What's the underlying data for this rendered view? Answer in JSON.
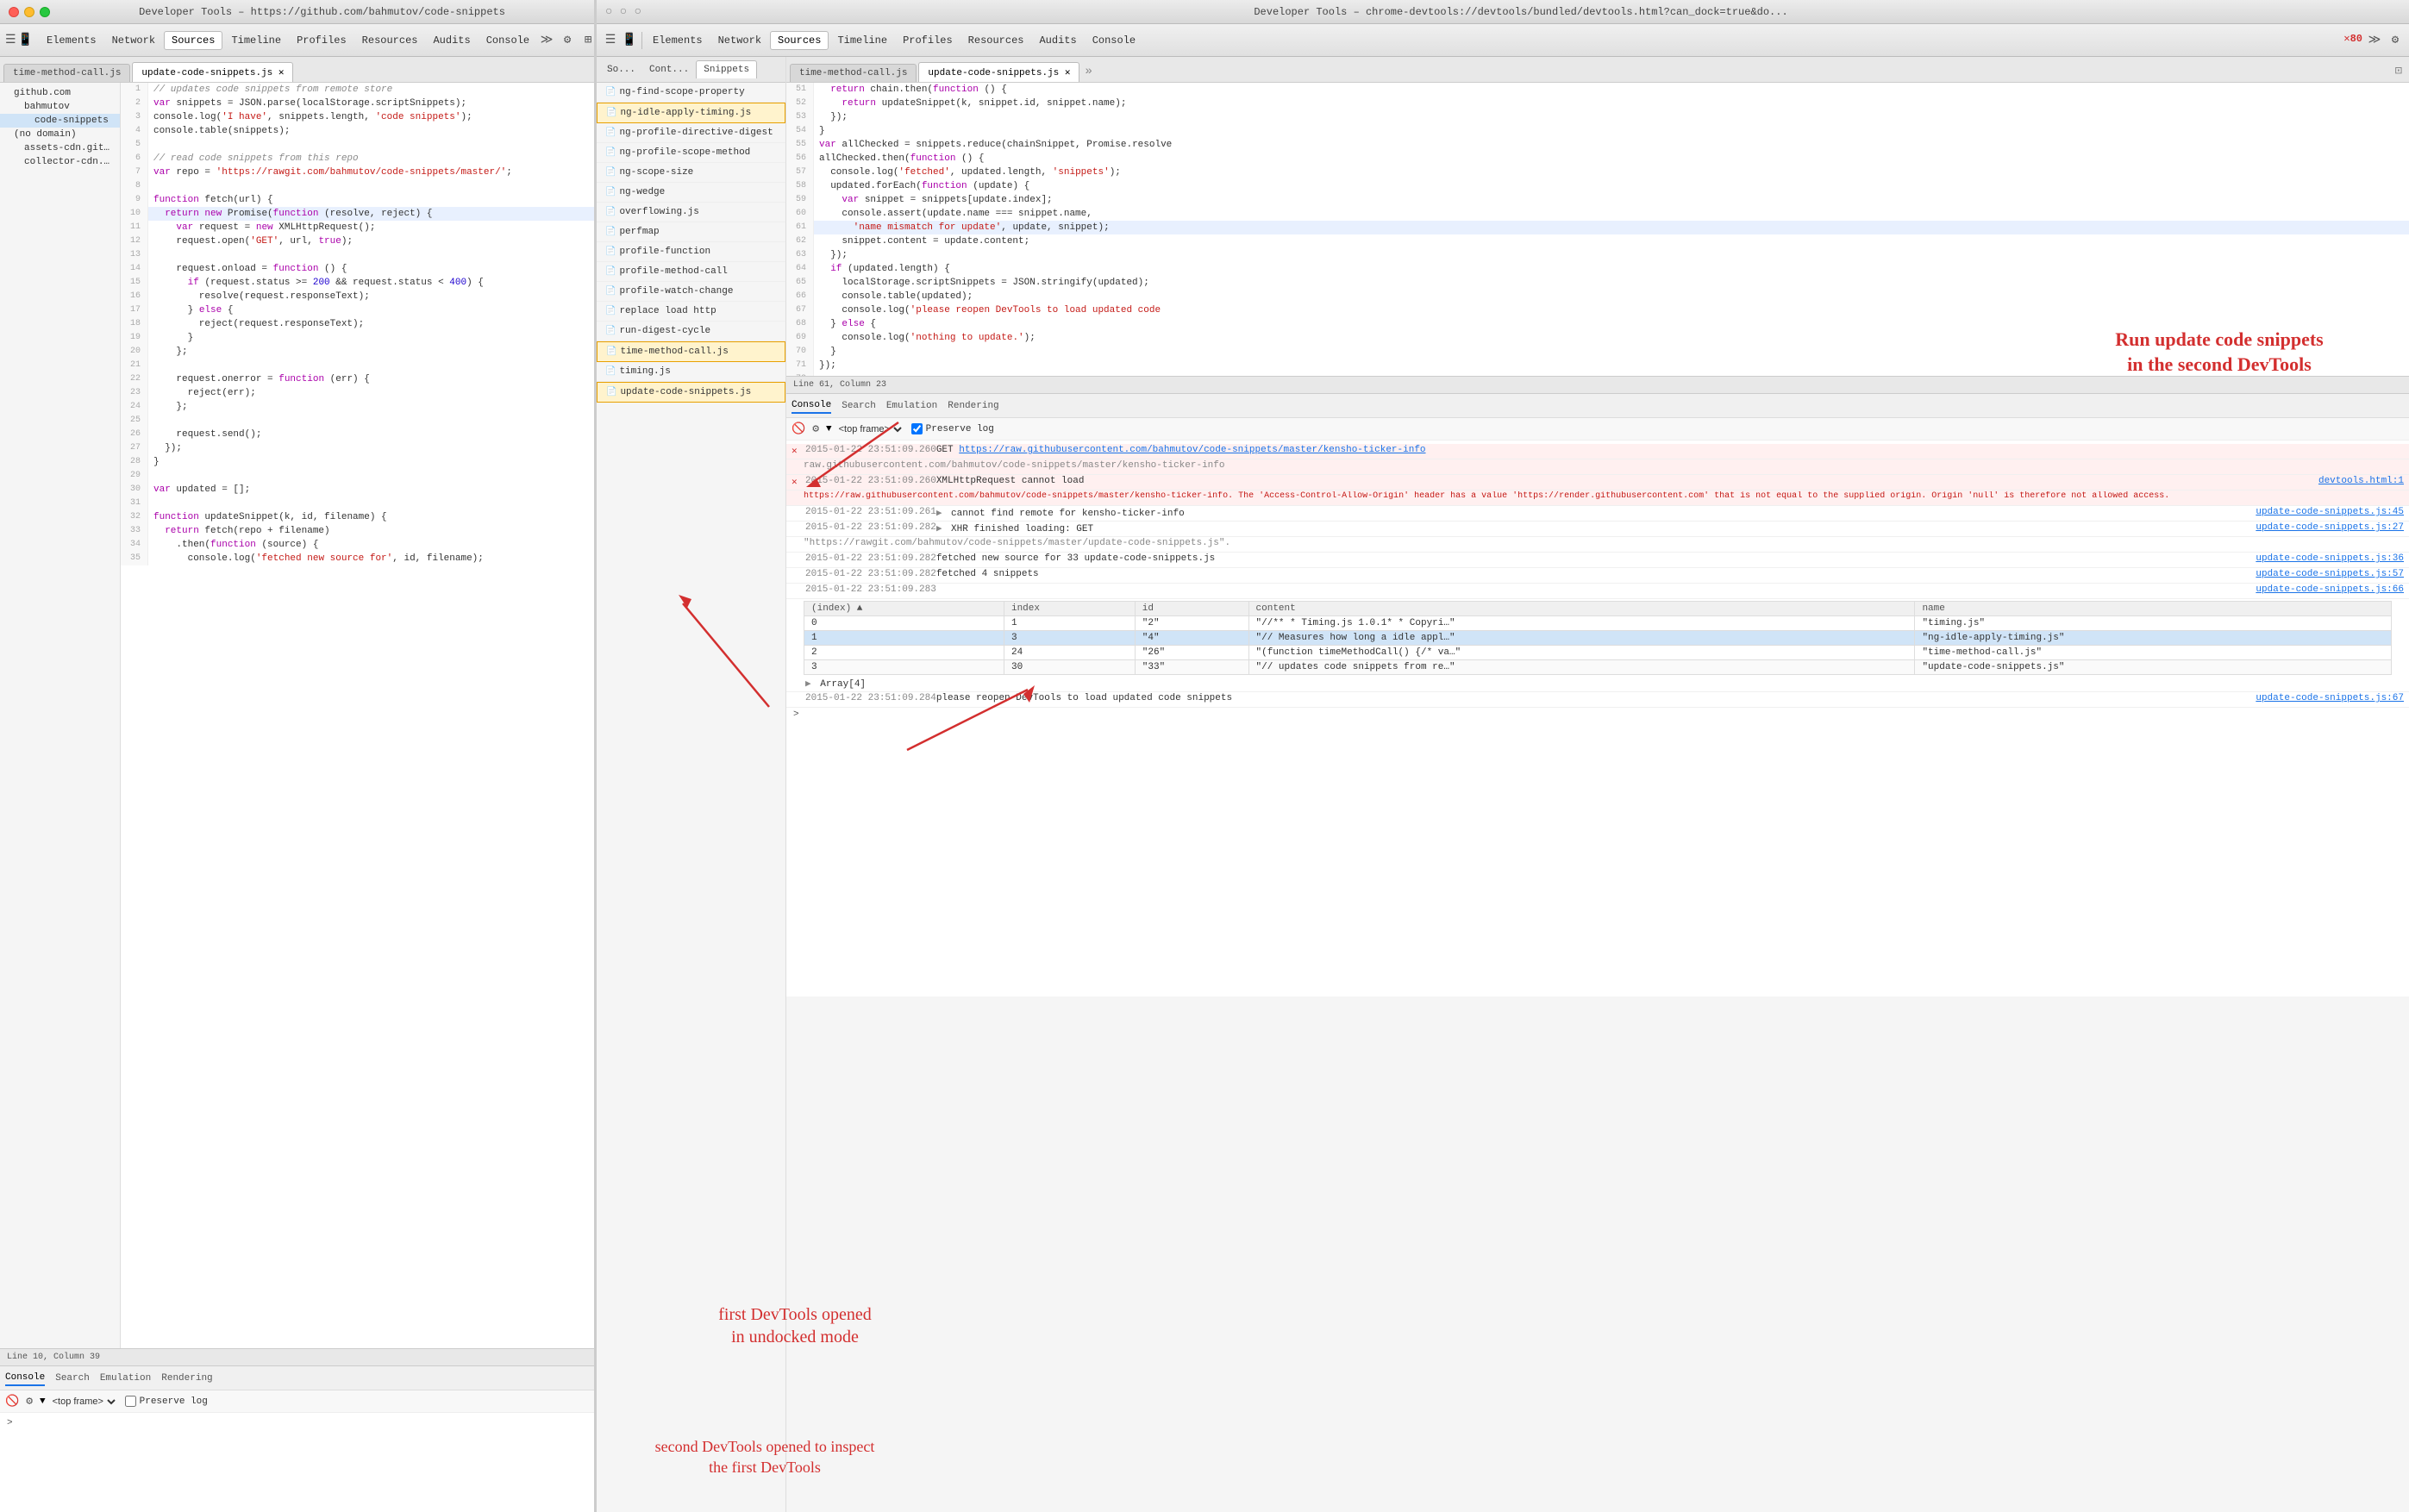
{
  "left": {
    "titlebar": "Developer Tools – https://github.com/bahmutov/code-snippets",
    "toolbar": {
      "items": [
        "Elements",
        "Network",
        "Sources",
        "Timeline",
        "Profiles",
        "Resources",
        "Audits",
        "Console"
      ]
    },
    "filetabs": [
      {
        "label": "time-method-call.js",
        "active": false
      },
      {
        "label": "update-code-snippets.js",
        "active": true
      }
    ],
    "sidebar": {
      "items": [
        {
          "label": "github.com",
          "indent": 1
        },
        {
          "label": "bahmutov",
          "indent": 2
        },
        {
          "label": "code-snippets",
          "indent": 3,
          "selected": true
        },
        {
          "label": "(no domain)",
          "indent": 1
        },
        {
          "label": "assets-cdn.github",
          "indent": 2
        },
        {
          "label": "collector-cdn.gith",
          "indent": 2
        }
      ]
    },
    "code": {
      "lines": [
        {
          "n": 1,
          "c": "// updates code snippets from remote store"
        },
        {
          "n": 2,
          "c": "var snippets = JSON.parse(localStorage.scriptSnippets);"
        },
        {
          "n": 3,
          "c": "console.log('I have', snippets.length, 'code snippets');"
        },
        {
          "n": 4,
          "c": "console.table(snippets);"
        },
        {
          "n": 5,
          "c": ""
        },
        {
          "n": 6,
          "c": "// read code snippets from this repo"
        },
        {
          "n": 7,
          "c": "var repo = 'https://rawgit.com/bahmutov/code-snippets/master/';"
        },
        {
          "n": 8,
          "c": ""
        },
        {
          "n": 9,
          "c": "function fetch(url) {"
        },
        {
          "n": 10,
          "c": "  return new Promise(function (resolve, reject) {"
        },
        {
          "n": 11,
          "c": "    var request = new XMLHttpRequest();"
        },
        {
          "n": 12,
          "c": "    request.open('GET', url, true);"
        },
        {
          "n": 13,
          "c": ""
        },
        {
          "n": 14,
          "c": "    request.onload = function () {"
        },
        {
          "n": 15,
          "c": "      if (request.status >= 200 && request.status < 400) {"
        },
        {
          "n": 16,
          "c": "        resolve(request.responseText);"
        },
        {
          "n": 17,
          "c": "      } else {"
        },
        {
          "n": 18,
          "c": "        reject(request.responseText);"
        },
        {
          "n": 19,
          "c": "      }"
        },
        {
          "n": 20,
          "c": "    };"
        },
        {
          "n": 21,
          "c": ""
        },
        {
          "n": 22,
          "c": "    request.onerror = function (err) {"
        },
        {
          "n": 23,
          "c": "      reject(err);"
        },
        {
          "n": 24,
          "c": "    };"
        },
        {
          "n": 25,
          "c": ""
        },
        {
          "n": 26,
          "c": "    request.send();"
        },
        {
          "n": 27,
          "c": "  });"
        },
        {
          "n": 28,
          "c": "}"
        },
        {
          "n": 29,
          "c": ""
        },
        {
          "n": 30,
          "c": "var updated = [];"
        },
        {
          "n": 31,
          "c": ""
        },
        {
          "n": 32,
          "c": "function updateSnippet(k, id, filename) {"
        },
        {
          "n": 33,
          "c": "  return fetch(repo + filename)"
        },
        {
          "n": 34,
          "c": "    .then(function (source) {"
        },
        {
          "n": 35,
          "c": "      console.log('fetched new source for', id, filename);"
        }
      ]
    },
    "statusbar": "Line 10, Column 39",
    "console": {
      "tabs": [
        "Console",
        "Search",
        "Emulation",
        "Rendering"
      ],
      "activeTab": "Console",
      "frameSelect": "<top frame>",
      "preserveLog": "Preserve log",
      "prompt": ">"
    }
  },
  "right": {
    "titlebar": "Developer Tools – chrome-devtools://devtools/bundled/devtools.html?can_dock=true&do...",
    "toolbar": {
      "items": [
        "Elements",
        "Network",
        "Sources",
        "Timeline",
        "Profiles",
        "Resources",
        "Audits",
        "Console"
      ]
    },
    "sourcesTabs": [
      "So...",
      "Co...",
      "Sni..."
    ],
    "snippetsList": [
      {
        "label": "ng-find-scope-property"
      },
      {
        "label": "ng-idle-apply-timing.js",
        "highlighted": true
      },
      {
        "label": "ng-profile-directive-digest"
      },
      {
        "label": "ng-profile-scope-method"
      },
      {
        "label": "ng-scope-size"
      },
      {
        "label": "ng-wedge"
      },
      {
        "label": "overflowing.js"
      },
      {
        "label": "perfmap"
      },
      {
        "label": "profile-function"
      },
      {
        "label": "profile-method-call"
      },
      {
        "label": "profile-watch-change"
      },
      {
        "label": "replace load http"
      },
      {
        "label": "run-digest-cycle"
      },
      {
        "label": "time-method-call.js",
        "highlighted": true
      },
      {
        "label": "timing.js"
      },
      {
        "label": "update-code-snippets.js",
        "highlighted": true
      }
    ],
    "filetabs": [
      {
        "label": "time-method-call.js",
        "active": false
      },
      {
        "label": "update-code-snippets.js",
        "active": true
      }
    ],
    "code": {
      "lines": [
        {
          "n": 51,
          "c": "  return chain.then(function () {"
        },
        {
          "n": 52,
          "c": "    return updateSnippet(k, snippet.id, snippet.name);"
        },
        {
          "n": 53,
          "c": "  });"
        },
        {
          "n": 54,
          "c": "}"
        },
        {
          "n": 55,
          "c": "var allChecked = snippets.reduce(chainSnippet, Promise.resolve"
        },
        {
          "n": 56,
          "c": "allChecked.then(function () {"
        },
        {
          "n": 57,
          "c": "  console.log('fetched', updated.length, 'snippets');"
        },
        {
          "n": 58,
          "c": "  updated.forEach(function (update) {"
        },
        {
          "n": 59,
          "c": "    var snippet = snippets[update.index];"
        },
        {
          "n": 60,
          "c": "    console.assert(update.name === snippet.name,"
        },
        {
          "n": 61,
          "c": "      'name mismatch for update', update, snippet);"
        },
        {
          "n": 62,
          "c": "    snippet.content = update.content;"
        },
        {
          "n": 63,
          "c": "  });"
        },
        {
          "n": 64,
          "c": "  if (updated.length) {"
        },
        {
          "n": 65,
          "c": "    localStorage.scriptSnippets = JSON.stringify(updated);"
        },
        {
          "n": 66,
          "c": "    console.table(updated);"
        },
        {
          "n": 67,
          "c": "    console.log('please reopen DevTools to load updated code"
        },
        {
          "n": 68,
          "c": "  } else {"
        },
        {
          "n": 69,
          "c": "    console.log('nothing to update.');"
        },
        {
          "n": 70,
          "c": "  }"
        },
        {
          "n": 71,
          "c": "});"
        },
        {
          "n": 72,
          "c": ""
        }
      ]
    },
    "statusbar": "Line 61, Column 23",
    "console": {
      "tabs": [
        "Console",
        "Search",
        "Emulation",
        "Rendering"
      ],
      "activeTab": "Console",
      "frameSelect": "<top frame>",
      "preserveLog": "Preserve log",
      "logs": [
        {
          "type": "error",
          "timestamp": "2015-01-22 23:51:09.260",
          "msg": "GET https://raw.githubusercontent.com/bahmutov/code-snippets/master/kensho-ticker-info:1",
          "url": "https://raw.githubusercontent.com/bahmutov/code-raw.githubusercontent.com/bahmutov/code-snippets/master/kensho-ticker-info"
        },
        {
          "type": "error",
          "timestamp": "2015-01-22 23:51:09.260",
          "msg": "XMLHttpRequest cannot load devtools.html:1",
          "detail": "https://raw.githubusercontent.com/bahmutov/code-snippets/master/kensho-ticker-info. The 'Access-Control-Allow-Origin' header has a value 'https://render.githubusercontent.com' that is not equal to the supplied origin. Origin 'null' is therefore not allowed access."
        },
        {
          "type": "normal",
          "timestamp": "2015-01-22 23:51:09.261",
          "msg": "▶ cannot find remote for kensho-ticker-info",
          "src": "update-code-snippets.js:45"
        },
        {
          "type": "normal",
          "timestamp": "2015-01-22 23:51:09.282",
          "msg": "▶ XHR finished loading: GET update-code-snippets.js:27",
          "detail": "\"https://rawgit.com/bahmutov/code-snippets/master/update-code-snippets.js\"."
        },
        {
          "type": "normal",
          "timestamp": "2015-01-22 23:51:09.282",
          "msg": "fetched new source for 33 update-code-snippets.js",
          "src": "update-code-snippets.js:36"
        },
        {
          "type": "normal",
          "timestamp": "2015-01-22 23:51:09.282",
          "msg": "fetched 4 snippets",
          "src": "update-code-snippets.js:57"
        },
        {
          "type": "normal",
          "timestamp": "2015-01-22 23:51:09.283",
          "msg": "",
          "src": "update-code-snippets.js:66",
          "isTable": true
        },
        {
          "type": "normal",
          "timestamp": "2015-01-22 23:51:09.284",
          "msg": "please reopen DevTools to load updated code snippets",
          "src": "update-code-snippets.js:67"
        }
      ],
      "table": {
        "headers": [
          "(index)",
          "index",
          "id",
          "content",
          "name"
        ],
        "rows": [
          {
            "index": "0",
            "idx": "1",
            "id": "\"2\"",
            "content": "\"//** * Timing.js 1.0.1* * Copyri…\"",
            "name": "\"timing.js\""
          },
          {
            "index": "1",
            "idx": "3",
            "id": "\"4\"",
            "content": "\"// Measures how long a idle appl…\"",
            "name": "\"ng-idle-apply-timing.js\"",
            "highlighted": true
          },
          {
            "index": "2",
            "idx": "24",
            "id": "\"26\"",
            "content": "\"(function timeMethodCall() {/* va…\"",
            "name": "\"time-method-call.js\""
          },
          {
            "index": "3",
            "idx": "30",
            "id": "\"33\"",
            "content": "\"// updates code snippets from re…\"",
            "name": "\"update-code-snippets.js\""
          }
        ]
      },
      "arrayNote": "▶ Array[4]",
      "prompt": ">"
    }
  },
  "annotations": {
    "annotation1": "first DevTools opened\nin undocked mode",
    "annotation2": "second DevTools opened to inspect\nthe first DevTools",
    "annotation3": "Run update code snippets\nin the second DevTools"
  }
}
